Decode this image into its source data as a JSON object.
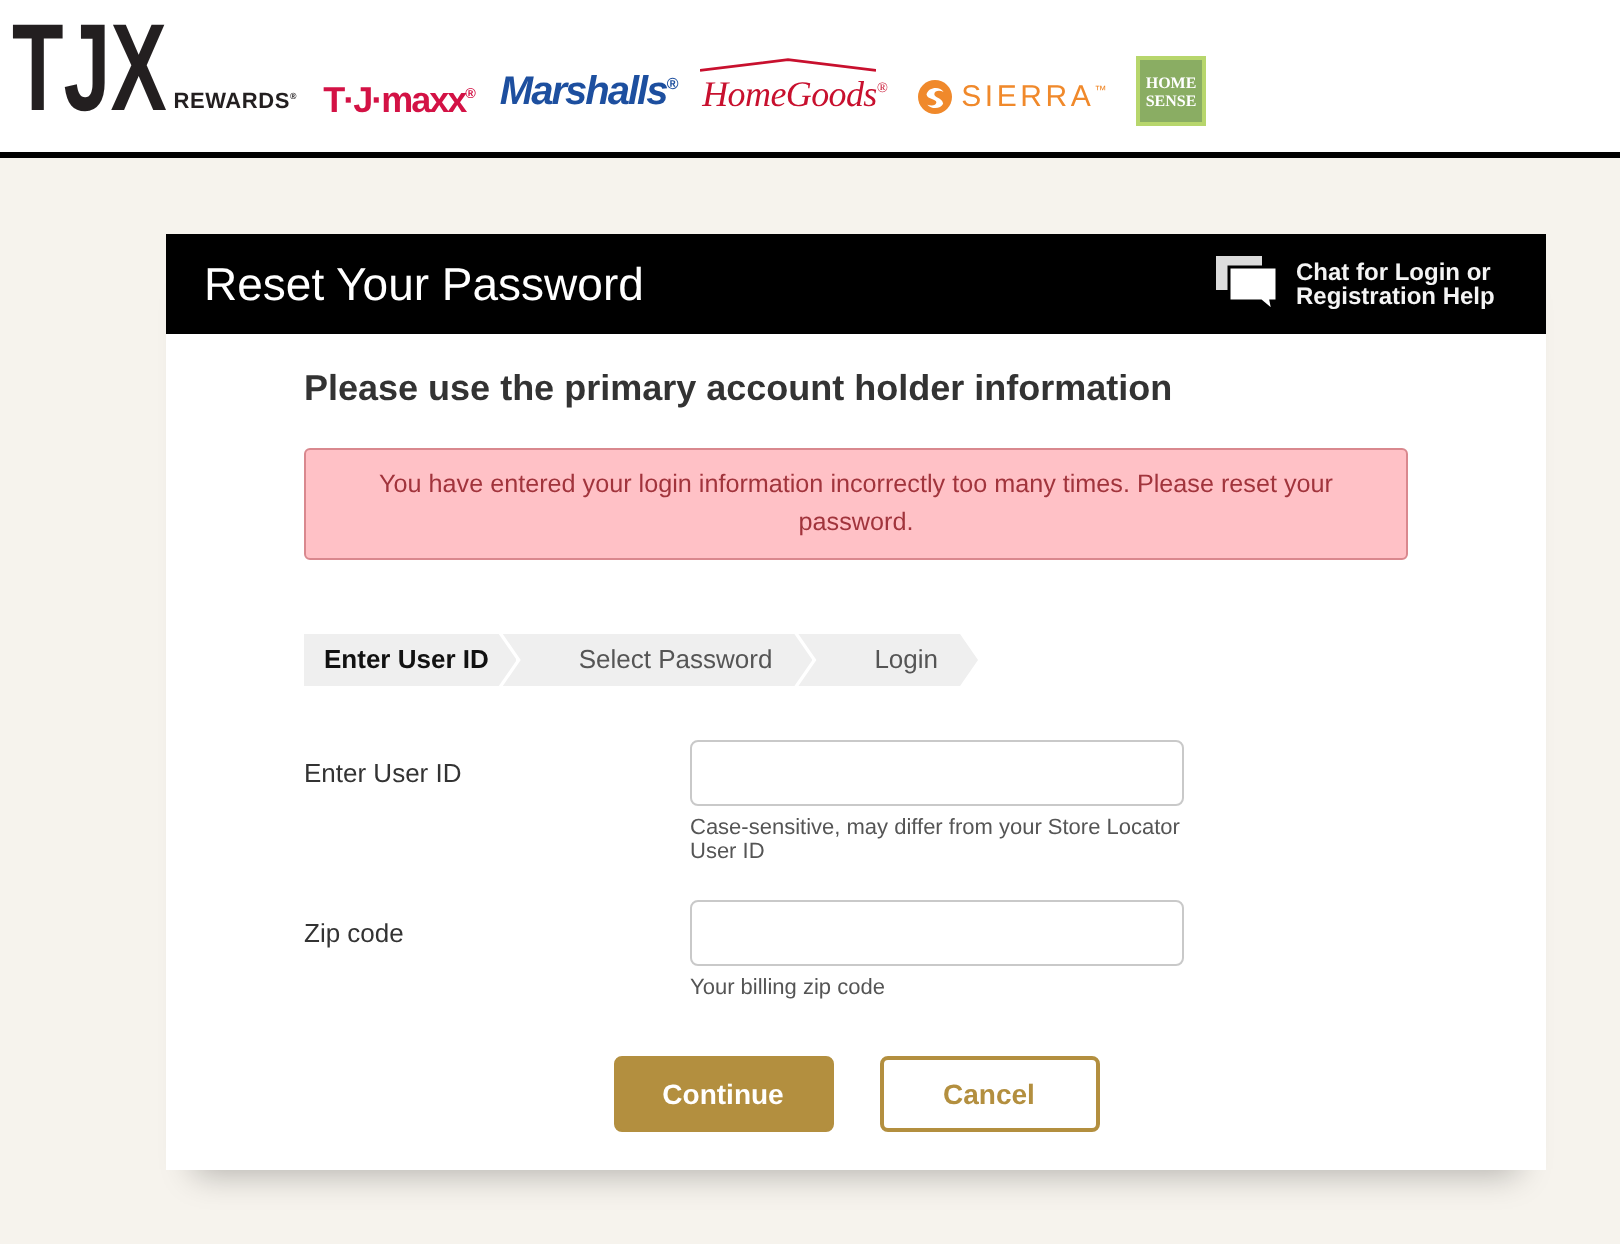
{
  "header": {
    "logos": [
      {
        "kind": "tjx",
        "text": "TJX",
        "tagline": "REWARDS$^{®}$"
      },
      {
        "kind": "tjmaxx",
        "text": "T·J·maxx$^{®}$"
      },
      {
        "kind": "marshalls",
        "text": "Marshalls$^{®}$"
      },
      {
        "kind": "homegoods",
        "text": "HomeGoods$^{®}$"
      },
      {
        "kind": "sierra",
        "text": "SIERRA$^{™}$"
      },
      {
        "kind": "homesense",
        "text": "HOME SENSE"
      }
    ]
  },
  "panel": {
    "title": "Reset Your Password",
    "chat_link": "Chat for Login or Registration Help",
    "heading": "Please use the primary account holder information",
    "alert": "You have entered your login information incorrectly too many times. Please reset your password.",
    "steps": [
      {
        "label": "Enter User ID",
        "selected": true
      },
      {
        "label": "Select Password",
        "selected": false
      },
      {
        "label": "Login",
        "selected": false
      }
    ],
    "fields": [
      {
        "label": "Enter User ID",
        "hint": "Case-sensitive, may differ from your Store Locator User ID"
      },
      {
        "label": "Zip code",
        "hint": "Your billing zip code"
      }
    ],
    "buttons": [
      {
        "label": "Continue",
        "kind": "primary"
      },
      {
        "label": "Cancel",
        "kind": "secondary"
      }
    ]
  }
}
